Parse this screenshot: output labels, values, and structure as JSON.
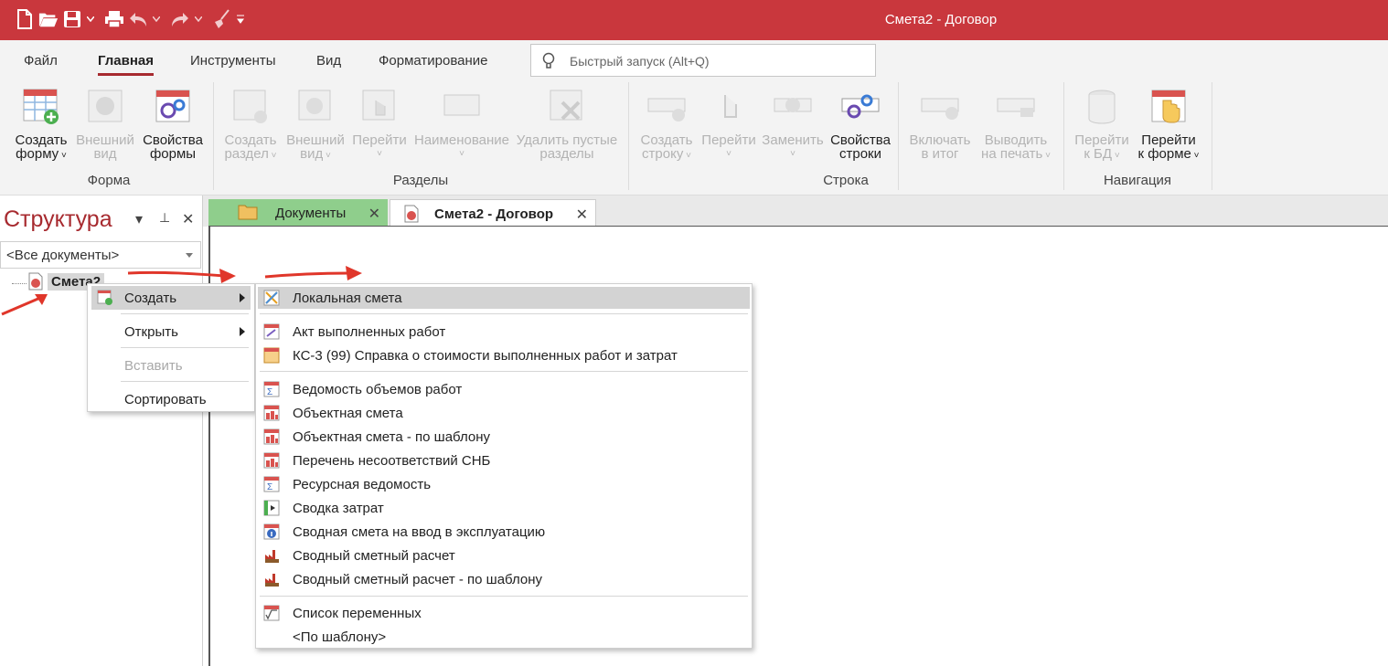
{
  "window": {
    "title": "Смета2 - Договор",
    "accent": "#c9373d"
  },
  "ribbon_tabs": [
    {
      "label": "Файл"
    },
    {
      "label": "Главная"
    },
    {
      "label": "Инструменты"
    },
    {
      "label": "Вид"
    },
    {
      "label": "Форматирование"
    }
  ],
  "quick_launch": {
    "placeholder": "Быстрый запуск (Alt+Q)"
  },
  "groups": {
    "forma": {
      "label": "Форма",
      "buttons": [
        {
          "l1": "Создать",
          "l2": "форму",
          "icon": "create-form-icon"
        },
        {
          "l1": "Внешний",
          "l2": "вид",
          "icon": "appearance-icon"
        },
        {
          "l1": "Свойства",
          "l2": "формы",
          "icon": "form-properties-icon"
        }
      ]
    },
    "razdely": {
      "label": "Разделы",
      "buttons": [
        {
          "l1": "Создать",
          "l2": "раздел"
        },
        {
          "l1": "Внешний",
          "l2": "вид"
        },
        {
          "l1": "Перейти",
          "l2": ""
        },
        {
          "l1": "Наименование",
          "l2": ""
        },
        {
          "l1": "Удалить пустые",
          "l2": "разделы"
        }
      ]
    },
    "stroka": {
      "label": "Строка",
      "buttons": [
        {
          "l1": "Создать",
          "l2": "строку"
        },
        {
          "l1": "Перейти",
          "l2": ""
        },
        {
          "l1": "Заменить",
          "l2": ""
        },
        {
          "l1": "Свойства",
          "l2": "строки"
        },
        {
          "l1": "Включать",
          "l2": "в итог"
        },
        {
          "l1": "Выводить",
          "l2": "на печать"
        }
      ]
    },
    "navigacia": {
      "label": "Навигация",
      "buttons": [
        {
          "l1": "Перейти",
          "l2": "к БД"
        },
        {
          "l1": "Перейти",
          "l2": "к форме"
        }
      ]
    }
  },
  "panel": {
    "title": "Структура",
    "filter": "<Все документы>",
    "tree_item": "Смета2"
  },
  "doc_tabs": [
    {
      "label": "Документы"
    },
    {
      "label": "Смета2 - Договор"
    }
  ],
  "context_menu": [
    {
      "label": "Создать"
    },
    {
      "label": "Открыть"
    },
    {
      "label": "Вставить"
    },
    {
      "label": "Сортировать"
    }
  ],
  "submenu": [
    {
      "label": "Локальная смета",
      "icon": "local-estimate-icon"
    },
    {
      "label": "Акт выполненных работ",
      "icon": "act-icon"
    },
    {
      "label": "КС-3 (99) Справка о стоимости выполненных работ и затрат",
      "icon": "ks3-icon"
    },
    {
      "label": "Ведомость объемов работ",
      "icon": "sum-report-icon"
    },
    {
      "label": "Объектная смета",
      "icon": "object-estimate-icon"
    },
    {
      "label": "Объектная смета - по шаблону",
      "icon": "object-estimate-icon"
    },
    {
      "label": "Перечень несоответствий СНБ",
      "icon": "object-estimate-icon"
    },
    {
      "label": "Ресурсная ведомость",
      "icon": "sum-report-icon"
    },
    {
      "label": "Сводка затрат",
      "icon": "cost-summary-icon"
    },
    {
      "label": "Сводная смета на ввод в эксплуатацию",
      "icon": "info-icon"
    },
    {
      "label": "Сводный сметный расчет",
      "icon": "factory-icon"
    },
    {
      "label": "Сводный сметный расчет - по шаблону",
      "icon": "factory-icon"
    },
    {
      "label": "Список переменных",
      "icon": "sqrt-icon"
    },
    {
      "label": "<По шаблону>",
      "icon": ""
    }
  ]
}
